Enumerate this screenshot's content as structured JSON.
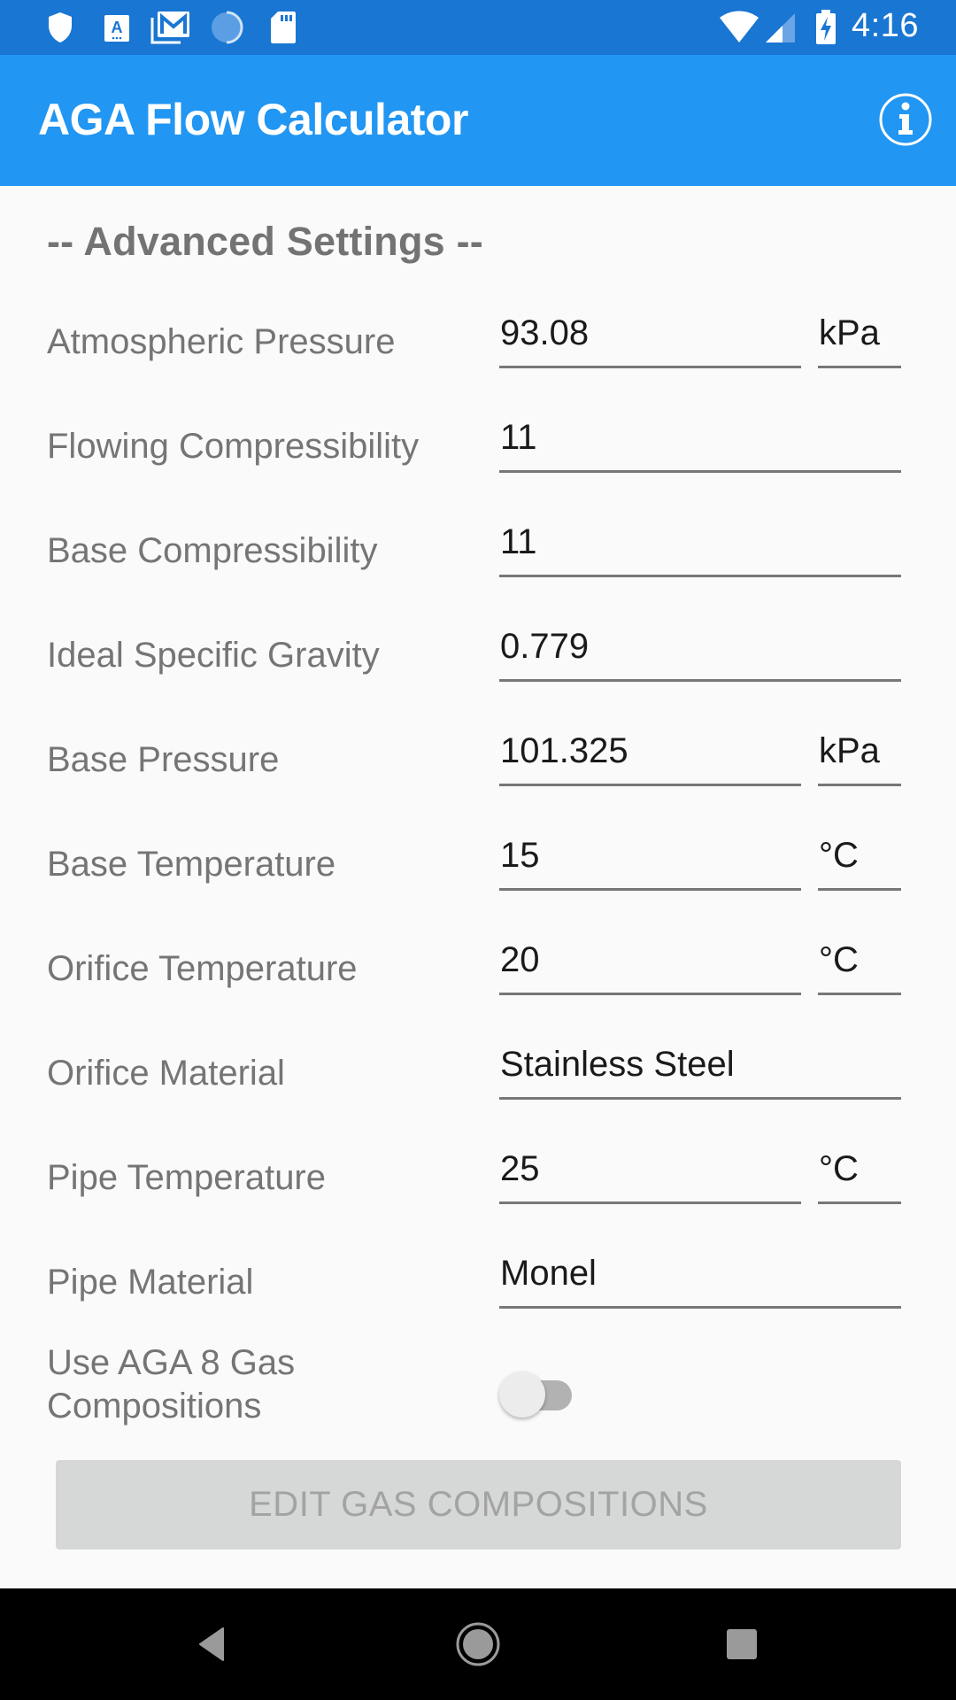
{
  "status_bar": {
    "time": "4:16",
    "left_icons": [
      "shield-icon",
      "keyboard-a-icon",
      "gmail-icon",
      "sync-loading-icon",
      "sd-card-icon"
    ],
    "right_icons": [
      "wifi-icon",
      "cellular-signal-icon",
      "battery-charging-icon"
    ]
  },
  "app_bar": {
    "title": "AGA Flow Calculator",
    "action_icon": "info-icon"
  },
  "section": {
    "heading": "-- Advanced Settings --"
  },
  "fields": [
    {
      "label": "Atmospheric Pressure",
      "value": "93.08",
      "unit": "kPa"
    },
    {
      "label": "Flowing Compressibility",
      "value": "11",
      "unit": null
    },
    {
      "label": "Base Compressibility",
      "value": "11",
      "unit": null
    },
    {
      "label": "Ideal Specific Gravity",
      "value": "0.779",
      "unit": null
    },
    {
      "label": "Base Pressure",
      "value": "101.325",
      "unit": "kPa"
    },
    {
      "label": "Base Temperature",
      "value": "15",
      "unit": "°C"
    },
    {
      "label": "Orifice Temperature",
      "value": "20",
      "unit": "°C"
    },
    {
      "label": "Orifice Material",
      "value": "Stainless Steel",
      "unit": null
    },
    {
      "label": "Pipe Temperature",
      "value": "25",
      "unit": "°C"
    },
    {
      "label": "Pipe Material",
      "value": "Monel",
      "unit": null
    }
  ],
  "aga8_toggle": {
    "label_line1": "Use AGA 8 Gas",
    "label_line2": "Compositions",
    "checked": false
  },
  "edit_button": {
    "label": "EDIT GAS COMPOSITIONS",
    "enabled": false
  },
  "nav_bar": {
    "buttons": [
      "back-icon",
      "home-icon",
      "recents-icon"
    ]
  },
  "colors": {
    "status_bar": "#1976D2",
    "app_bar": "#2196F3",
    "background": "#FAFAFA",
    "label_text": "#757575",
    "value_text": "#1A1A1A",
    "button_disabled_bg": "#D6D7D7",
    "button_disabled_text": "#A3A3A3"
  }
}
